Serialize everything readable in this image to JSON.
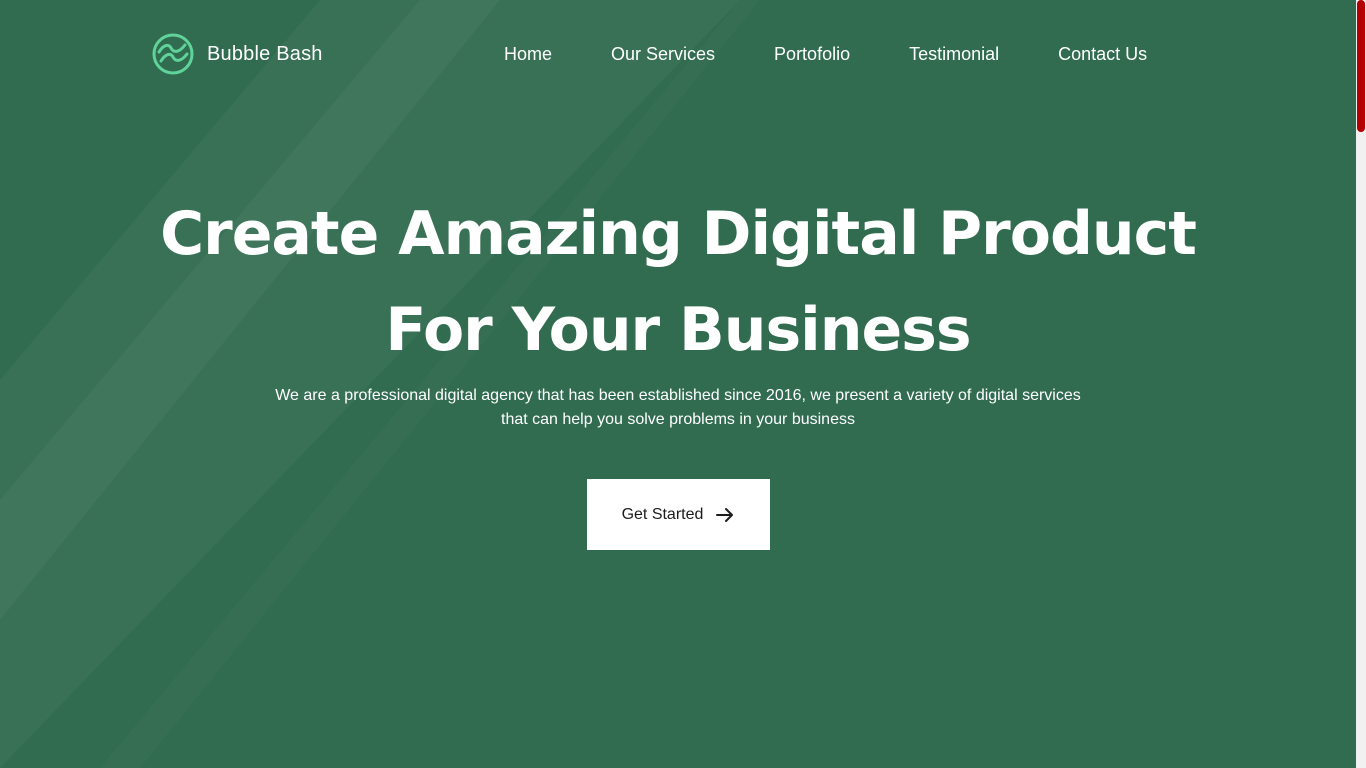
{
  "brand": {
    "name": "Bubble Bash",
    "logo_icon": "wave-circle-icon",
    "logo_color": "#5fd39a"
  },
  "nav": {
    "items": [
      {
        "label": "Home"
      },
      {
        "label": "Our Services"
      },
      {
        "label": "Portofolio"
      },
      {
        "label": "Testimonial"
      },
      {
        "label": "Contact Us"
      }
    ]
  },
  "hero": {
    "title_line1": "Create Amazing Digital Product",
    "title_line2": "For Your Business",
    "description_line1": "We are a professional digital agency that has been established since 2016, we present a variety of digital services",
    "description_line2": "that can help you solve problems in your business",
    "cta_label": "Get Started",
    "cta_icon": "arrow-right-icon"
  },
  "colors": {
    "background": "#316c50",
    "stripe": "#ffffff",
    "cta_background": "#ffffff",
    "cta_text": "#1c1c1c",
    "scrollbar_thumb": "#b30000"
  },
  "scrollbar": {
    "position_fraction": 0
  }
}
